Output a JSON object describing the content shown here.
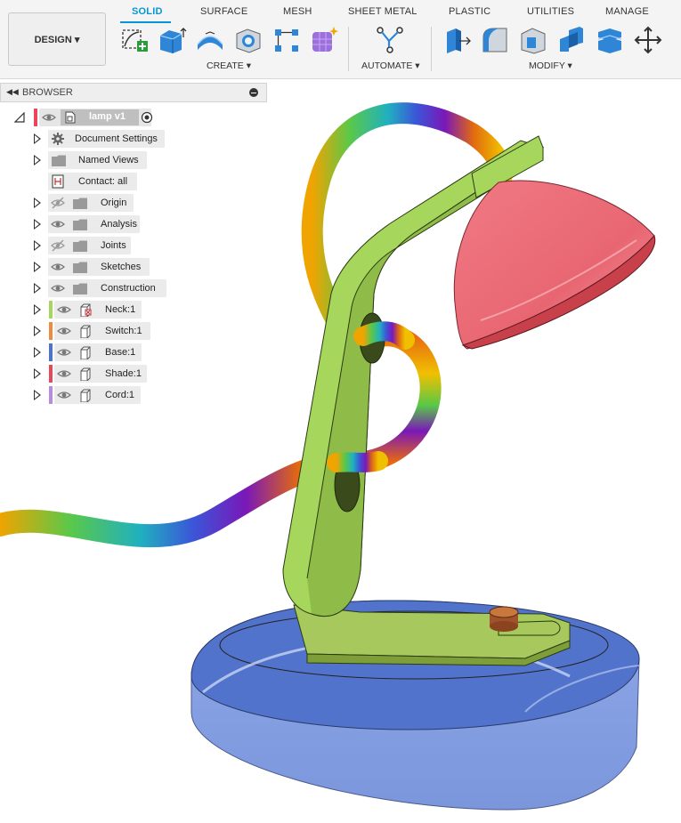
{
  "toolbar": {
    "design_label": "DESIGN ▾",
    "tabs": [
      "SOLID",
      "SURFACE",
      "MESH",
      "SHEET METAL",
      "PLASTIC",
      "UTILITIES",
      "MANAGE"
    ],
    "groups": {
      "create": "CREATE ▾",
      "automate": "AUTOMATE ▾",
      "modify": "MODIFY ▾"
    }
  },
  "browser": {
    "title": "BROWSER",
    "root": "lamp v1",
    "items": [
      {
        "label": "Document Settings",
        "icon": "gear-icon"
      },
      {
        "label": "Named Views",
        "icon": "folder-icon"
      },
      {
        "label": "Contact: all",
        "icon": "contact-icon"
      },
      {
        "label": "Origin",
        "icon": "folder-icon",
        "visible": false
      },
      {
        "label": "Analysis",
        "icon": "folder-icon",
        "visible": true
      },
      {
        "label": "Joints",
        "icon": "folder-icon",
        "visible": false
      },
      {
        "label": "Sketches",
        "icon": "folder-icon",
        "visible": true
      },
      {
        "label": "Construction",
        "icon": "folder-icon",
        "visible": true
      },
      {
        "label": "Neck:1",
        "icon": "component-icon",
        "color": "#a6d65c"
      },
      {
        "label": "Switch:1",
        "icon": "component-icon",
        "color": "#f08a3c"
      },
      {
        "label": "Base:1",
        "icon": "component-icon",
        "color": "#4a74d4"
      },
      {
        "label": "Shade:1",
        "icon": "component-icon",
        "color": "#e8485a"
      },
      {
        "label": "Cord:1",
        "icon": "component-icon",
        "color": "#b98be0"
      }
    ]
  },
  "colors": {
    "accent": "#0696d7",
    "neck": "#a6d65c",
    "switch": "#f08a3c",
    "base": "#4a74d4",
    "shade": "#e8485a",
    "cord": "#b98be0"
  }
}
